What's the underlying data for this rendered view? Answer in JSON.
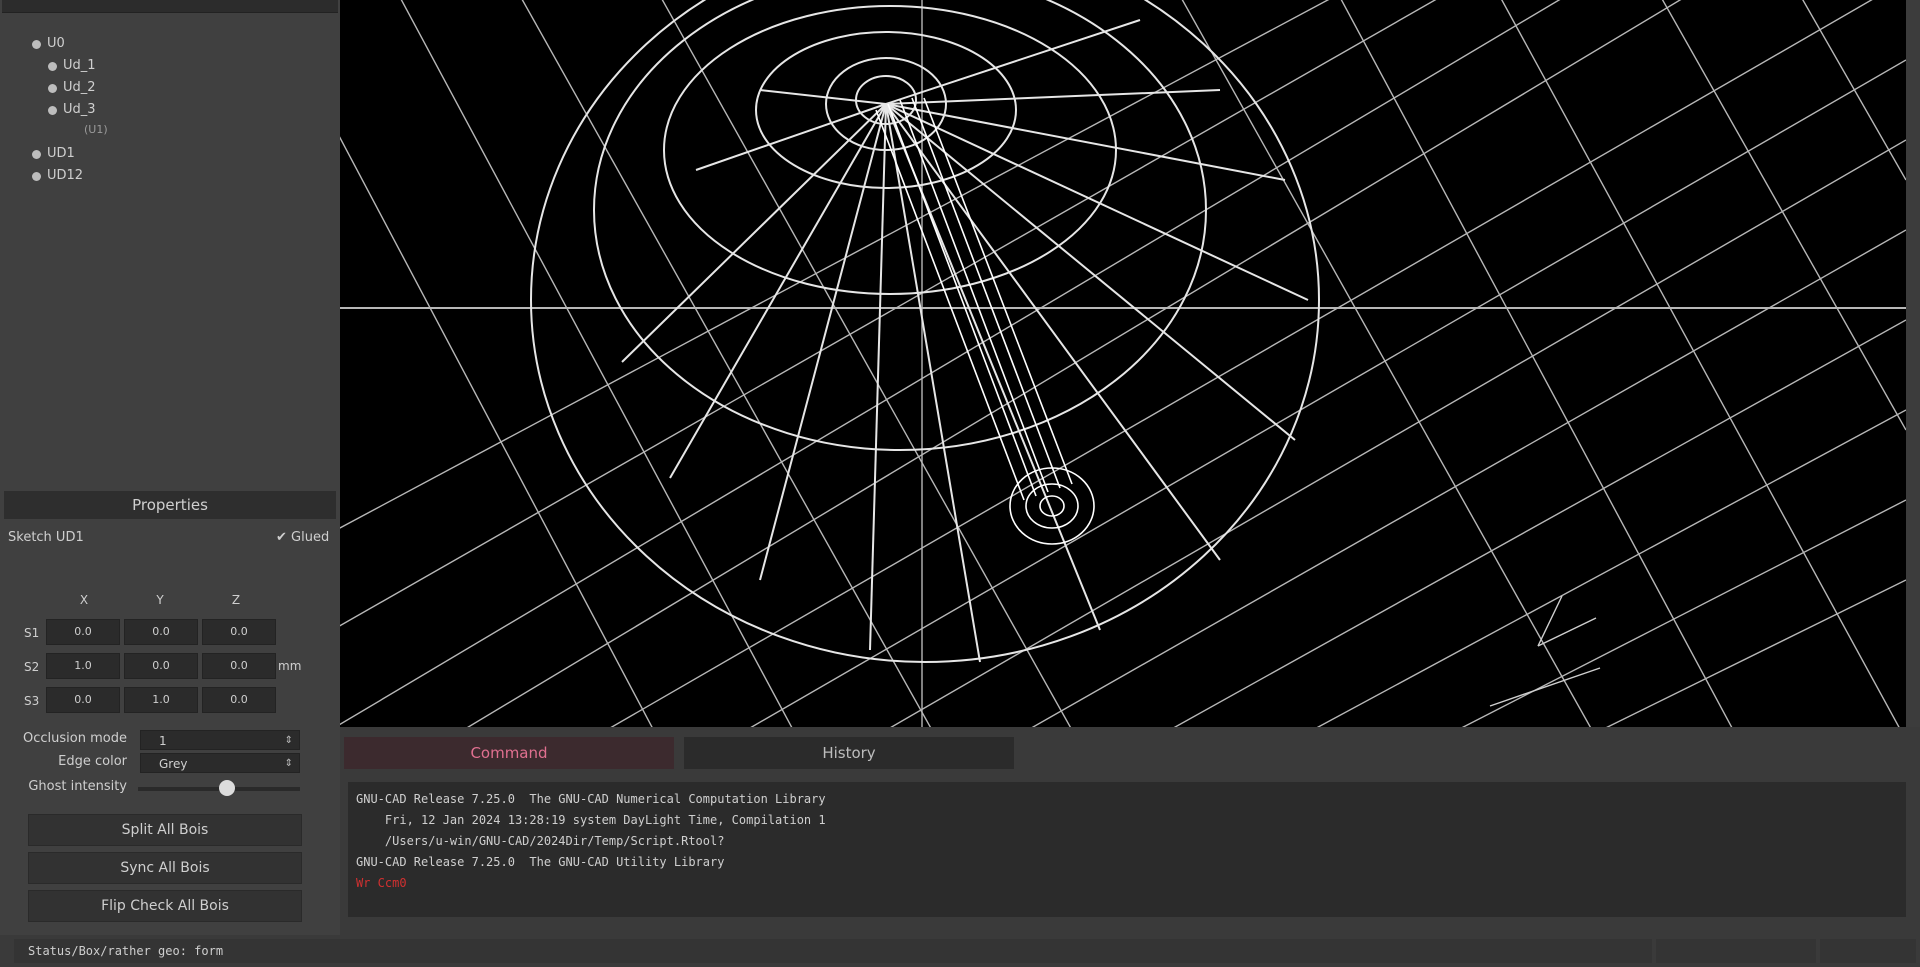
{
  "tree": {
    "root": "U0",
    "children": [
      {
        "label": "Ud_1"
      },
      {
        "label": "Ud_2"
      },
      {
        "label": "Ud_3",
        "sub": "(U1)"
      }
    ],
    "siblings": [
      "UD1",
      "UD12"
    ]
  },
  "properties": {
    "title": "Properties",
    "sketch_label": "Sketch UD1",
    "check_label": "✔ Glued",
    "columns": [
      "X",
      "Y",
      "Z"
    ],
    "rows": [
      {
        "label": "S1",
        "values": [
          "0.0",
          "0.0",
          "0.0"
        ]
      },
      {
        "label": "S2",
        "values": [
          "1.0",
          "0.0",
          "0.0"
        ],
        "unit": "mm"
      },
      {
        "label": "S3",
        "values": [
          "0.0",
          "1.0",
          "0.0"
        ]
      }
    ],
    "occlusion_label": "Occlusion mode",
    "occlusion_value": "1",
    "edge_label": "Edge color",
    "edge_value": "Grey",
    "ghost_label": "Ghost intensity",
    "ghost_level": 0.55,
    "buttons": [
      "Split All Bois",
      "Sync All Bois",
      "Flip Check All Bois"
    ]
  },
  "tabs": {
    "command": "Command",
    "history": "History"
  },
  "console": {
    "lines": [
      {
        "text": "GNU-CAD Release 7.25.0  The GNU-CAD Numerical Computation Library",
        "color": "#cfcfcf"
      },
      {
        "text": "    Fri, 12 Jan 2024 13:28:19 system DayLight Time, Compilation 1",
        "color": "#cfcfcf"
      },
      {
        "text": "    /Users/u-win/GNU-CAD/2024Dir/Temp/Script.Rtool?",
        "color": "#cfcfcf"
      },
      {
        "text": "GNU-CAD Release 7.25.0  The GNU-CAD Utility Library",
        "color": "#cfcfcf"
      },
      {
        "text": "Wr Ccm0",
        "color": "#d23030"
      }
    ]
  },
  "status": {
    "text": "Status/Box/rather geo: form"
  }
}
